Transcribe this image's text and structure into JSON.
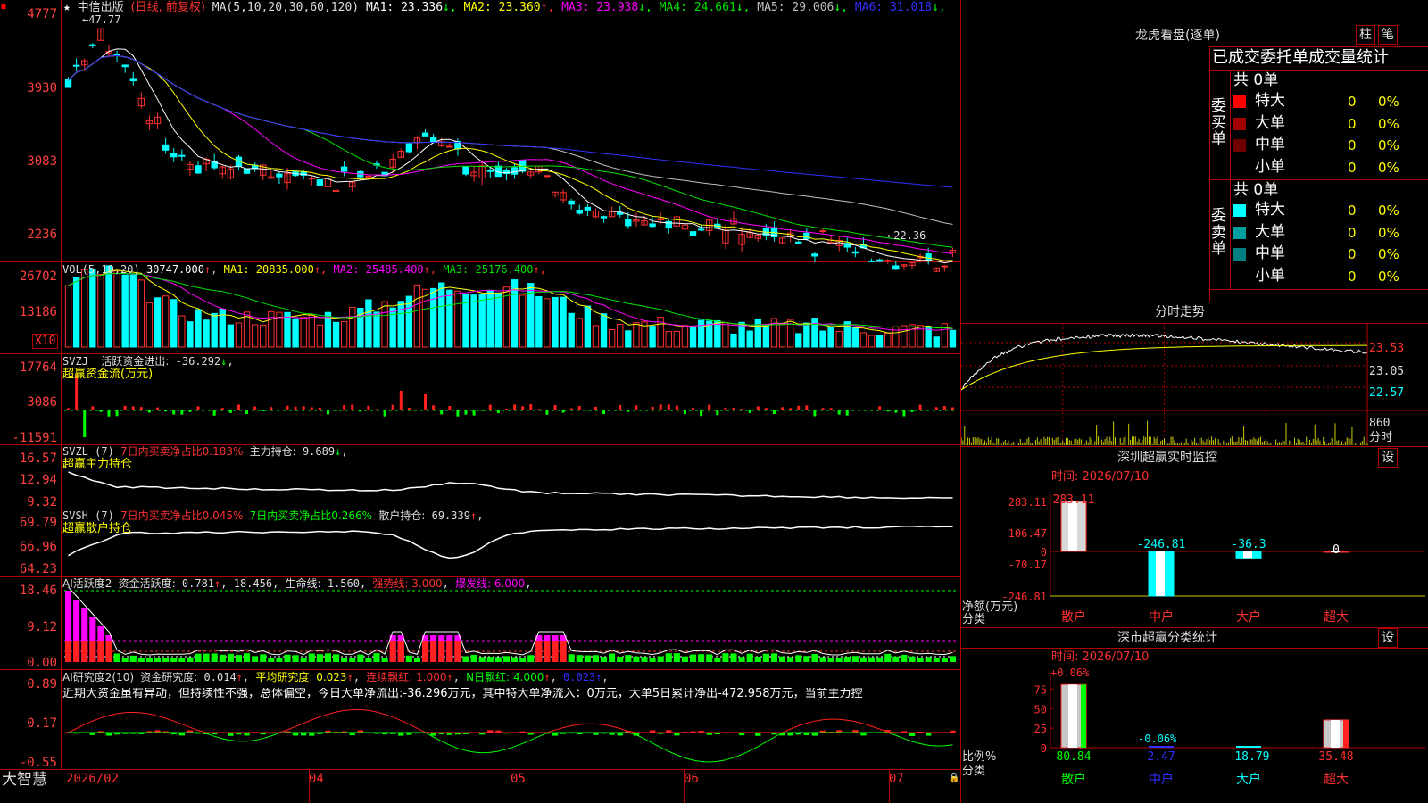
{
  "stock": {
    "name": "中信出版",
    "mode": "(日线, 前复权)",
    "high_marker": "47.77",
    "low_marker": "22.36",
    "ma_label": "MA(5,10,20,30,60,120)",
    "ma": [
      {
        "label": "MA1:",
        "value": "23.336",
        "dir": "↓",
        "color": "#ffffff"
      },
      {
        "label": "MA2:",
        "value": "23.360",
        "dir": "↑",
        "color": "#ffff00"
      },
      {
        "label": "MA3:",
        "value": "23.938",
        "dir": "↓",
        "color": "#ff00ff"
      },
      {
        "label": "MA4:",
        "value": "24.661",
        "dir": "↓",
        "color": "#00e000"
      },
      {
        "label": "MA5:",
        "value": "29.006",
        "dir": "↓",
        "color": "#c0c0c0"
      },
      {
        "label": "MA6:",
        "value": "31.018",
        "dir": "↓",
        "color": "#3030ff"
      }
    ],
    "y_ticks": [
      "4777",
      "3930",
      "3083",
      "2236"
    ]
  },
  "vol": {
    "label": "VOL(5,10,20)",
    "value": "30747.000",
    "ma": [
      {
        "label": "MA1:",
        "value": "20835.000",
        "color": "#ffff00"
      },
      {
        "label": "MA2:",
        "value": "25485.400",
        "color": "#ff00ff"
      },
      {
        "label": "MA3:",
        "value": "25176.400",
        "color": "#00e000"
      }
    ],
    "y_ticks": [
      "26702",
      "13186"
    ],
    "unit": "X10"
  },
  "svzj": {
    "label": "SVZJ",
    "desc": "活跃资金进出:",
    "value": "-36.292",
    "subtitle": "超赢资金流(万元)",
    "y_ticks": [
      "17764",
      "3086",
      "-11591"
    ]
  },
  "svzl": {
    "label": "SVZL (7)",
    "ratio_text": "7日内买卖净占比0.183%",
    "hold_label": "主力持仓:",
    "hold_value": "9.689",
    "subtitle": "超赢主力持仓",
    "y_ticks": [
      "16.57",
      "12.94",
      "9.32"
    ]
  },
  "svsh": {
    "label": "SVSH (7)",
    "ratio1": "7日内买卖净占比0.045%",
    "ratio2": "7日内买卖净占比0.266%",
    "hold_label": "散户持仓:",
    "hold_value": "69.339",
    "subtitle": "超赢散户持仓",
    "y_ticks": [
      "69.79",
      "66.96",
      "64.23"
    ]
  },
  "ai_active": {
    "label": "AI活跃度2",
    "desc": "资金活跃度:",
    "value": "0.781",
    "value2": "18.456",
    "life_label": "生命线:",
    "life_value": "1.560",
    "strong": "强势线: 3.000",
    "burst": "爆发线: 6.000",
    "y_ticks": [
      "18.46",
      "9.12",
      "0.00"
    ]
  },
  "ai_research": {
    "label": "AI研究度2(10)",
    "desc": "资金研究度:",
    "value": "0.014",
    "avg": "平均研究度: 0.023",
    "red": "连续飘红: 1.000",
    "nred": "N日飘红: 4.000",
    "last": "0.023",
    "comment": "近期大资金虽有异动，但持续性不强，总体偏空，今日大单净流出:-36.296万元，其中特大单净流入：0万元，大单5日累计净出-472.958万元，当前主力控",
    "y_ticks": [
      "0.89",
      "0.17",
      "-0.55"
    ]
  },
  "x_axis": {
    "brand": "大智慧",
    "labels": [
      "2026/02",
      "04",
      "05",
      "06",
      "07"
    ]
  },
  "dragon": {
    "title": "龙虎看盘(逐单)",
    "btn_bar": "柱",
    "btn_pen": "笔",
    "header": "已成交委托单成交量统计",
    "buy_label": "委买单",
    "sell_label": "委卖单",
    "buy_total": "共 0单",
    "sell_total": "共 0单",
    "buy_rows": [
      {
        "name": "特大",
        "count": "0",
        "pct": "0%",
        "color": "#ff0000"
      },
      {
        "name": "大单",
        "count": "0",
        "pct": "0%",
        "color": "#a00000"
      },
      {
        "name": "中单",
        "count": "0",
        "pct": "0%",
        "color": "#700000"
      },
      {
        "name": "小单",
        "count": "0",
        "pct": "0%",
        "color": ""
      }
    ],
    "sell_rows": [
      {
        "name": "特大",
        "count": "0",
        "pct": "0%",
        "color": "#00ffff"
      },
      {
        "name": "大单",
        "count": "0",
        "pct": "0%",
        "color": "#00a0a0"
      },
      {
        "name": "中单",
        "count": "0",
        "pct": "0%",
        "color": "#008080"
      },
      {
        "name": "小单",
        "count": "0",
        "pct": "0%",
        "color": ""
      }
    ]
  },
  "intraday": {
    "title": "分时走势",
    "right_ticks": [
      "23.53",
      "23.05",
      "22.57"
    ],
    "vol_tick": "860",
    "vol_unit": "分时"
  },
  "sz_monitor": {
    "title": "深圳超赢实时监控",
    "btn": "设",
    "time_label": "时间: 2026/07/10",
    "y_ticks": [
      "283.11",
      "106.47",
      "0",
      "-70.17",
      "-246.81"
    ],
    "y_caption": "净额(万元)",
    "x_caption": "分类",
    "bars": [
      {
        "cat": "散户",
        "value": 283.11,
        "label": "283.11"
      },
      {
        "cat": "中户",
        "value": -246.81,
        "label": "-246.81"
      },
      {
        "cat": "大户",
        "value": -36.3,
        "label": "-36.3"
      },
      {
        "cat": "超大",
        "value": 0,
        "label": "0"
      }
    ]
  },
  "sz_class": {
    "title": "深市超赢分类统计",
    "btn": "设",
    "time_label": "时间: 2026/07/10",
    "y_ticks": [
      "75",
      "50",
      "25",
      "0"
    ],
    "y_caption": "比例%",
    "x_caption": "分类",
    "top_label": "+0.06%",
    "mid_label": "-0.06%",
    "bars": [
      {
        "cat": "散户",
        "value": 80.84,
        "label": "80.84"
      },
      {
        "cat": "中户",
        "value": 2.47,
        "label": "2.47"
      },
      {
        "cat": "大户",
        "value": -18.79,
        "label": "-18.79"
      },
      {
        "cat": "超大",
        "value": 35.48,
        "label": "35.48"
      }
    ]
  }
}
